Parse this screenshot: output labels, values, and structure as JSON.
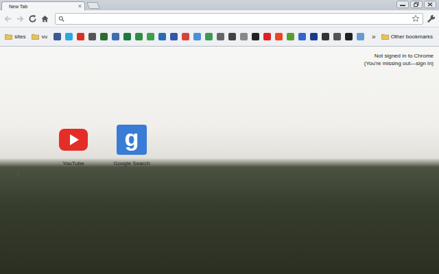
{
  "window": {
    "title": "New Tab"
  },
  "tabs": [
    {
      "label": "New Tab",
      "selected": true,
      "close": "×"
    }
  ],
  "toolbar": {
    "back": {
      "disabled": true
    },
    "forward": {
      "disabled": true
    }
  },
  "bookmarks": [
    {
      "kind": "folder",
      "label": "sites"
    },
    {
      "kind": "folder",
      "label": "vu"
    },
    {
      "kind": "icon",
      "color": "#3b5998"
    },
    {
      "kind": "icon",
      "color": "#29a9e1"
    },
    {
      "kind": "icon",
      "color": "#d93025"
    },
    {
      "kind": "icon",
      "color": "#555555"
    },
    {
      "kind": "icon",
      "color": "#2d6a2d"
    },
    {
      "kind": "icon",
      "color": "#3b6fb0"
    },
    {
      "kind": "icon",
      "color": "#1b7a3e"
    },
    {
      "kind": "icon",
      "color": "#2c8f3f"
    },
    {
      "kind": "icon",
      "color": "#3aa04a"
    },
    {
      "kind": "icon",
      "color": "#2a6bb0"
    },
    {
      "kind": "icon",
      "color": "#3355aa"
    },
    {
      "kind": "icon",
      "color": "#d44638"
    },
    {
      "kind": "icon",
      "color": "#4a90d9"
    },
    {
      "kind": "icon",
      "color": "#3d9a54"
    },
    {
      "kind": "icon",
      "color": "#666666"
    },
    {
      "kind": "icon",
      "color": "#444444"
    },
    {
      "kind": "icon",
      "color": "#888888"
    },
    {
      "kind": "icon",
      "color": "#222222"
    },
    {
      "kind": "icon",
      "color": "#dd2222"
    },
    {
      "kind": "icon",
      "color": "#ee4422"
    },
    {
      "kind": "icon",
      "color": "#5a9e2f"
    },
    {
      "kind": "icon",
      "color": "#3366cc"
    },
    {
      "kind": "icon",
      "color": "#1a3a8a"
    },
    {
      "kind": "icon",
      "color": "#333333"
    },
    {
      "kind": "icon",
      "color": "#555555"
    },
    {
      "kind": "icon",
      "color": "#222222"
    },
    {
      "kind": "icon",
      "color": "#6a9ad0"
    }
  ],
  "overflow": "»",
  "other_bookmarks": "Other bookmarks",
  "sign_in": {
    "line1": "Not signed in to Chrome",
    "line2": "(You're missing out—sign in)"
  },
  "apps": [
    {
      "label": "YouTube",
      "kind": "youtube",
      "color": "#e52d27"
    },
    {
      "label": "Google Search",
      "kind": "google",
      "color": "#3a7bd5",
      "glyph": "g"
    }
  ],
  "pager": {
    "prev": "‹"
  }
}
